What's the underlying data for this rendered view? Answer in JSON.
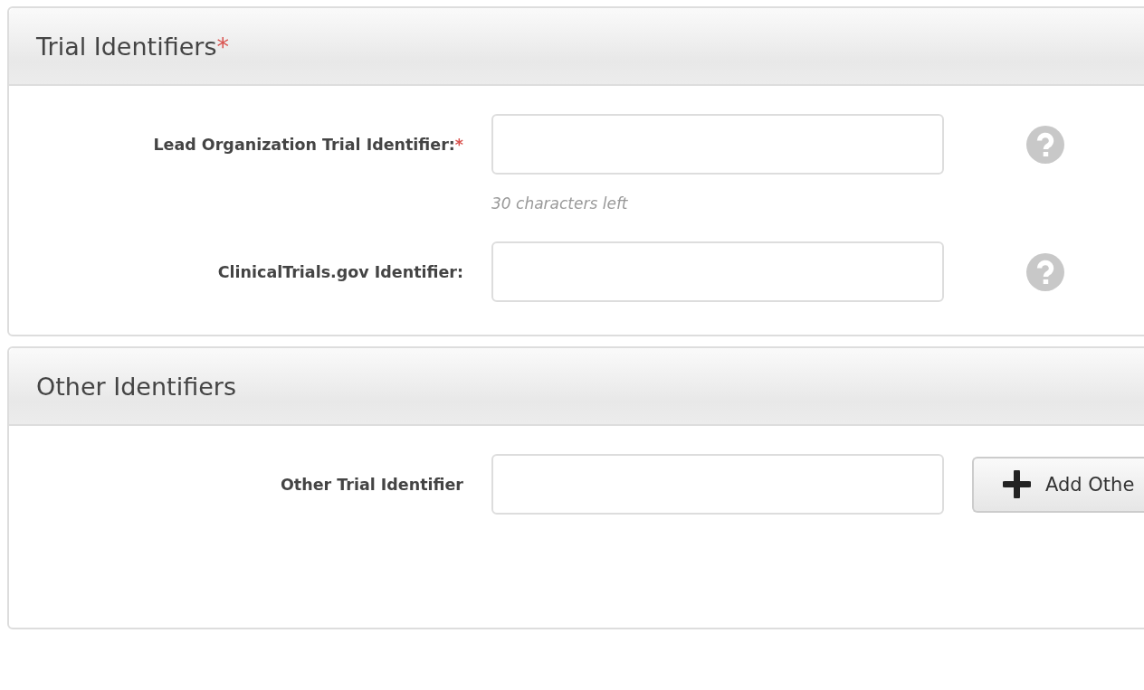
{
  "panels": [
    {
      "title": "Trial Identifiers",
      "required_mark": "*",
      "rows": [
        {
          "kind": "field-help",
          "label": "Lead Organization Trial Identifier:",
          "required_mark": "*",
          "hint": "30 characters left"
        },
        {
          "kind": "field-help",
          "label": "ClinicalTrials.gov Identifier:"
        }
      ]
    },
    {
      "title": "Other Identifiers",
      "rows": [
        {
          "kind": "field-button",
          "label": "Other Trial Identifier",
          "button": "Add Othe"
        }
      ]
    }
  ]
}
